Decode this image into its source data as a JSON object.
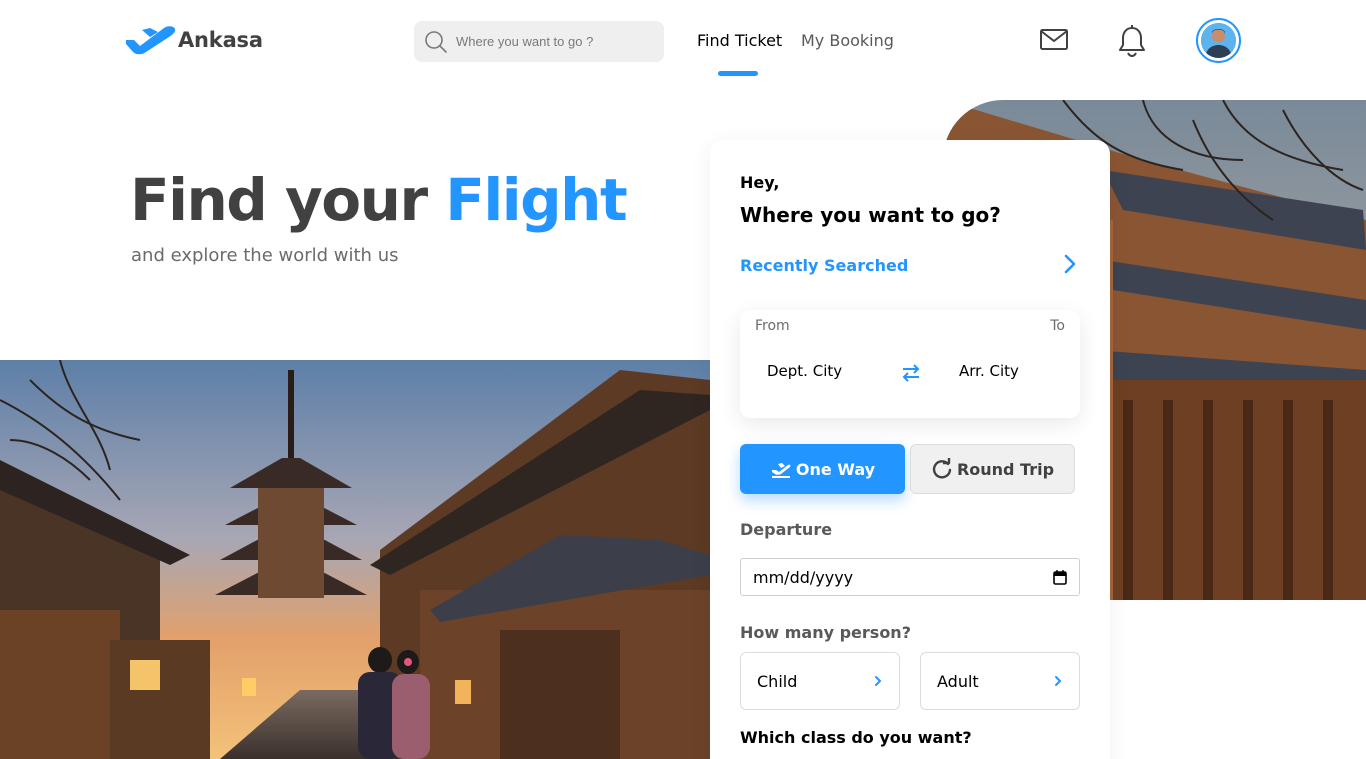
{
  "header": {
    "brand": "Ankasa",
    "search_placeholder": "Where you want to go ?",
    "nav_find_ticket": "Find Ticket",
    "nav_my_booking": "My Booking"
  },
  "hero": {
    "title_main": "Find your ",
    "title_accent": "Flight",
    "subtitle": "and explore the world with us"
  },
  "card": {
    "greeting": "Hey,",
    "question": "Where you want to go?",
    "recently_searched": "Recently Searched",
    "from_label": "From",
    "to_label": "To",
    "departure_city": "Dept. City",
    "arrival_city": "Arr. City",
    "one_way_label": "One Way",
    "round_trip_label": "Round Trip",
    "departure_label": "Departure",
    "date_placeholder": "mm/dd/yyyy",
    "person_label": "How many person?",
    "child_label": "Child",
    "adult_label": "Adult",
    "class_label": "Which class do you want?"
  },
  "colors": {
    "accent": "#2395ff",
    "text_dark": "#414141",
    "muted": "#6b6b6b"
  },
  "icons": {
    "logo": "plane-logo-icon",
    "search": "search-icon",
    "mail": "mail-icon",
    "bell": "bell-icon",
    "recent_chevron": "chevron-right-icon",
    "swap": "swap-arrows-icon",
    "one_way": "plane-takeoff-icon",
    "round_trip": "refresh-icon",
    "calendar": "calendar-icon"
  }
}
